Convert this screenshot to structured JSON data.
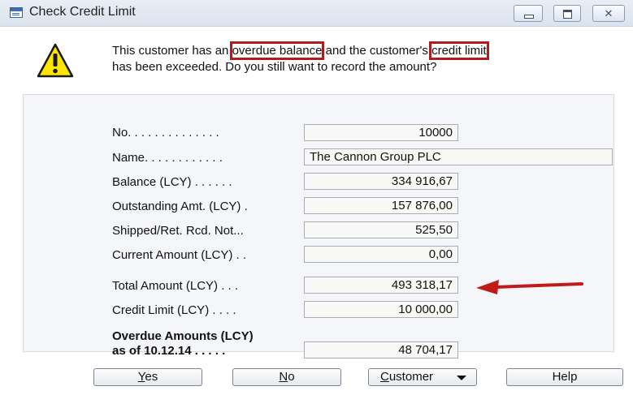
{
  "window": {
    "title": "Check Credit Limit",
    "close_glyph": "✕"
  },
  "message": {
    "line1_before": "This customer has an ",
    "line1_hl1": "overdue balance",
    "line1_middle": " and the customer's ",
    "line1_hl2": "credit limit",
    "line2": "has been exceeded. Do you still want to record the amount?",
    "icon": "warning-icon",
    "highlight_color": "#b01b1b"
  },
  "fields": {
    "no": {
      "label": "No. . . . . . . . . . . . . .",
      "value": "10000"
    },
    "name": {
      "label": "Name. . . . . . . . . . . .",
      "value": "The Cannon Group PLC"
    },
    "balance": {
      "label": "Balance (LCY) . . . . . .",
      "value": "334 916,67"
    },
    "outstanding": {
      "label": "Outstanding Amt. (LCY) .",
      "value": "157 876,00"
    },
    "shipped": {
      "label": "Shipped/Ret. Rcd. Not...",
      "value": "525,50"
    },
    "current": {
      "label": "Current Amount (LCY) . .",
      "value": "0,00"
    },
    "total": {
      "label": "Total Amount (LCY) . . .",
      "value": "493 318,17"
    },
    "credit_limit": {
      "label": "Credit Limit (LCY) . . . .",
      "value": "10 000,00"
    },
    "overdue": {
      "label_line1": "Overdue Amounts (LCY)",
      "label_line2": "as of 10.12.14 . . . . .",
      "value": "48 704,17"
    }
  },
  "buttons": {
    "yes_key": "Y",
    "yes_rest": "es",
    "no_key": "N",
    "no_rest": "o",
    "customer_key": "C",
    "customer_rest": "ustomer",
    "help": "Help"
  },
  "colors": {
    "arrow": "#c01a1a",
    "warning_fill": "#ffe600"
  }
}
